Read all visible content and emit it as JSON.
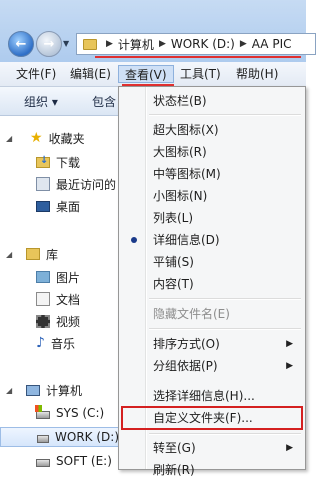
{
  "address": {
    "segments": [
      "计算机",
      "WORK (D:)",
      "AA PIC"
    ]
  },
  "menubar": {
    "file": "文件(F)",
    "edit": "编辑(E)",
    "view": "查看(V)",
    "tools": "工具(T)",
    "help": "帮助(H)"
  },
  "commandbar": {
    "organize": "组织 ▾",
    "include": "包含"
  },
  "nav": {
    "favorites": "收藏夹",
    "downloads": "下载",
    "recent": "最近访问的",
    "desktop": "桌面",
    "libraries": "库",
    "pictures": "图片",
    "documents": "文档",
    "videos": "视频",
    "music": "音乐",
    "computer": "计算机",
    "sys_c": "SYS (C:)",
    "work_d": "WORK (D:)",
    "soft_e": "SOFT (E:)"
  },
  "view_menu": {
    "statusbar": "状态栏(B)",
    "xl_icons": "超大图标(X)",
    "l_icons": "大图标(R)",
    "m_icons": "中等图标(M)",
    "s_icons": "小图标(N)",
    "list": "列表(L)",
    "details": "详细信息(D)",
    "tiles": "平铺(S)",
    "content": "内容(T)",
    "hide_ext": "隐藏文件名(E)",
    "sort_by": "排序方式(O)",
    "group_by": "分组依据(P)",
    "choose_details": "选择详细信息(H)...",
    "customize": "自定义文件夹(F)...",
    "goto": "转至(G)",
    "refresh": "刷新(R)"
  }
}
